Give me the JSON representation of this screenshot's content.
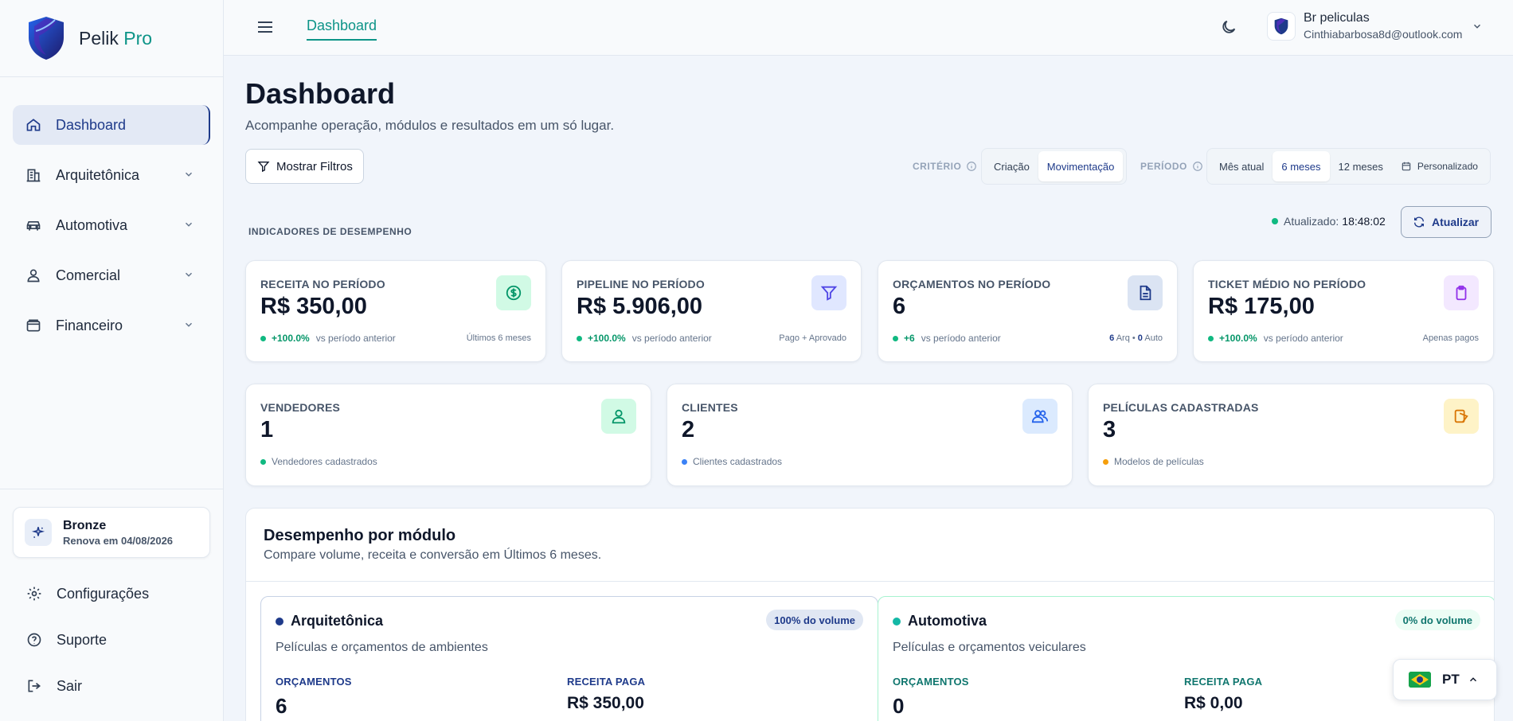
{
  "app": {
    "name": "Pelik",
    "name_suffix": "Pro"
  },
  "sidebar": {
    "items": [
      {
        "label": "Dashboard",
        "icon": "home-icon",
        "active": true
      },
      {
        "label": "Arquitetônica",
        "icon": "building-icon"
      },
      {
        "label": "Automotiva",
        "icon": "car-icon"
      },
      {
        "label": "Comercial",
        "icon": "users-icon"
      },
      {
        "label": "Financeiro",
        "icon": "wallet-icon"
      }
    ],
    "plan": {
      "name": "Bronze",
      "renewal": "Renova em 04/08/2026"
    },
    "bottom": [
      {
        "label": "Configurações",
        "icon": "gear-icon"
      },
      {
        "label": "Suporte",
        "icon": "help-icon"
      },
      {
        "label": "Sair",
        "icon": "logout-icon"
      }
    ]
  },
  "header": {
    "tab": "Dashboard",
    "user": {
      "name": "Br peliculas",
      "email": "Cinthiabarbosa8d@outlook.com"
    }
  },
  "page": {
    "title": "Dashboard",
    "subtitle": "Acompanhe operação, módulos e resultados em um só lugar.",
    "filters_button": "Mostrar Filtros",
    "criterio_label": "CRITÉRIO",
    "criterio_options": [
      "Criação",
      "Movimentação"
    ],
    "criterio_selected": "Movimentação",
    "periodo_label": "PERÍODO",
    "periodo_options": [
      "Mês atual",
      "6 meses",
      "12 meses",
      "Personalizado"
    ],
    "periodo_selected": "6 meses",
    "section_label": "INDICADORES DE DESEMPENHO",
    "updated_label": "Atualizado:",
    "updated_time": "18:48:02",
    "refresh_button": "Atualizar"
  },
  "kpis": [
    {
      "title": "RECEITA NO PERÍODO",
      "value": "R$ 350,00",
      "delta": "+100.0%",
      "vs": "vs período anterior",
      "note": "Últimos 6 meses",
      "icon": "dollar-icon"
    },
    {
      "title": "PIPELINE NO PERÍODO",
      "value": "R$ 5.906,00",
      "delta": "+100.0%",
      "vs": "vs período anterior",
      "note": "Pago + Aprovado",
      "icon": "funnel-icon"
    },
    {
      "title": "ORÇAMENTOS NO PERÍODO",
      "value": "6",
      "delta": "+6",
      "vs": "vs período anterior",
      "note_arq_n": "6",
      "note_arq": "Arq •",
      "note_auto_n": "0",
      "note_auto": "Auto",
      "icon": "document-icon"
    },
    {
      "title": "TICKET MÉDIO NO PERÍODO",
      "value": "R$ 175,00",
      "delta": "+100.0%",
      "vs": "vs período anterior",
      "note": "Apenas pagos",
      "icon": "clipboard-icon"
    }
  ],
  "counts": [
    {
      "title": "VENDEDORES",
      "value": "1",
      "foot": "Vendedores cadastrados",
      "icon": "user-icon"
    },
    {
      "title": "CLIENTES",
      "value": "2",
      "foot": "Clientes cadastrados",
      "icon": "users-icon"
    },
    {
      "title": "PELÍCULAS CADASTRADAS",
      "value": "3",
      "foot": "Modelos de películas",
      "icon": "film-icon"
    }
  ],
  "performance": {
    "title": "Desempenho por módulo",
    "subtitle": "Compare volume, receita e conversão em Últimos 6 meses.",
    "modules": [
      {
        "name": "Arquitetônica",
        "badge": "100% do volume",
        "desc": "Películas e orçamentos de ambientes",
        "orc_label": "ORÇAMENTOS",
        "orc_value": "6",
        "rec_label": "RECEITA PAGA",
        "rec_value": "R$ 350,00"
      },
      {
        "name": "Automotiva",
        "badge": "0% do volume",
        "desc": "Películas e orçamentos veiculares",
        "orc_label": "ORÇAMENTOS",
        "orc_value": "0",
        "rec_label": "RECEITA PAGA",
        "rec_value": "R$ 0,00"
      }
    ]
  },
  "language": {
    "code": "PT"
  },
  "colors": {
    "accent": "#0d9488",
    "brand": "#1e3a8a",
    "positive": "#10b981"
  }
}
